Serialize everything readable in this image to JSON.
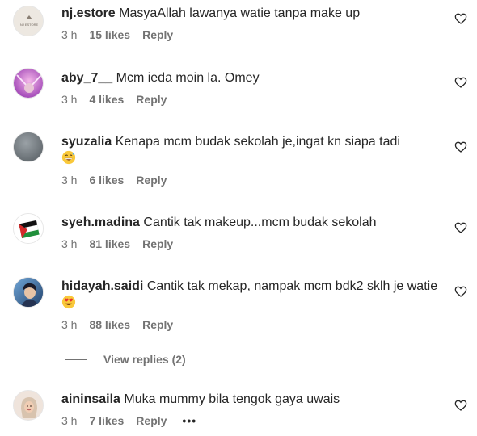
{
  "comments": [
    {
      "username": "nj.estore",
      "text": "MasyaAllah lawanya watie tanpa make up",
      "time": "3 h",
      "likes": "15 likes",
      "reply": "Reply",
      "avatar_label": "NJ ESTORE"
    },
    {
      "username": "aby_7__",
      "text": "Mcm ieda moin la. Omey",
      "time": "3 h",
      "likes": "4 likes",
      "reply": "Reply"
    },
    {
      "username": "syuzalia",
      "text": "Kenapa mcm budak sekolah je,ingat kn siapa tadi",
      "emoji": "grinning-sweat-emoji",
      "time": "3 h",
      "likes": "6 likes",
      "reply": "Reply"
    },
    {
      "username": "syeh.madina",
      "text": "Cantik tak makeup...mcm budak sekolah",
      "time": "3 h",
      "likes": "81 likes",
      "reply": "Reply"
    },
    {
      "username": "hidayah.saidi",
      "text": "Cantik tak mekap, nampak mcm bdk2 sklh je watie",
      "emoji": "heart-eyes-emoji",
      "time": "3 h",
      "likes": "88 likes",
      "reply": "Reply"
    },
    {
      "username": "aininsaila",
      "text": "Muka mummy bila tengok gaya uwais",
      "time": "3 h",
      "likes": "7 likes",
      "reply": "Reply",
      "more": "•••"
    }
  ],
  "view_replies": "View replies (2)",
  "colors": {
    "text": "#262626",
    "secondary": "#737373",
    "heart_outline": "#262626"
  }
}
